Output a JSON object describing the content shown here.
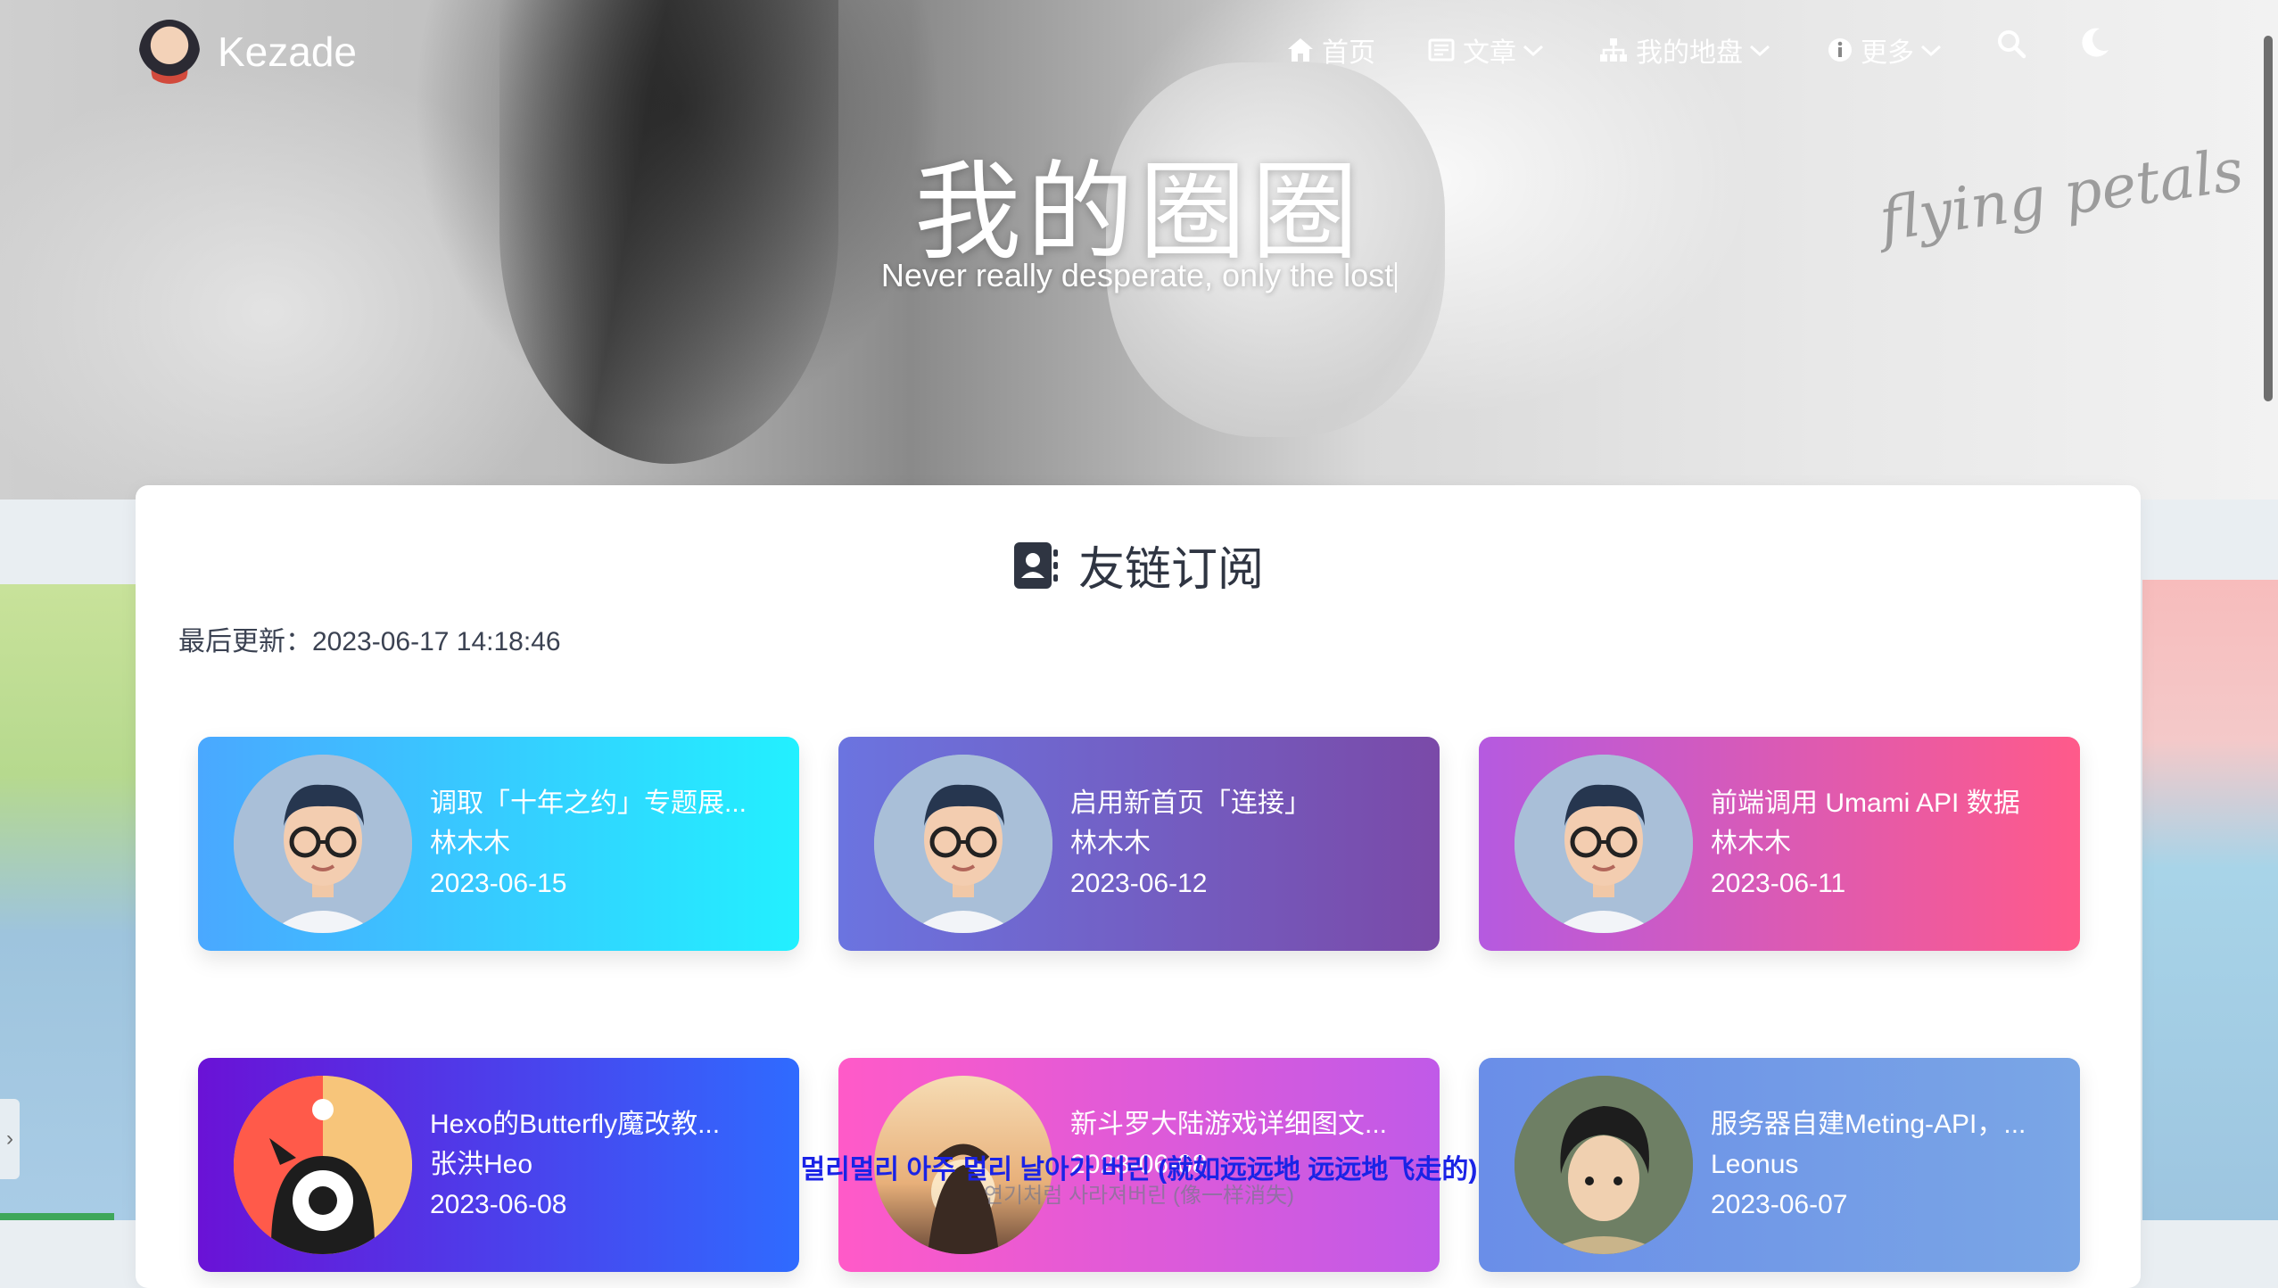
{
  "nav": {
    "brand": "Kezade",
    "items": [
      {
        "label": "首页",
        "icon": "home-icon"
      },
      {
        "label": "文章",
        "icon": "book-icon"
      },
      {
        "label": "我的地盘",
        "icon": "sitemap-icon"
      },
      {
        "label": "更多",
        "icon": "info-icon"
      }
    ],
    "search_icon": "search-icon",
    "theme_icon": "moon-icon"
  },
  "hero": {
    "title": "我的圈圈",
    "subtitle": "Never really desperate, only the lost",
    "watermark": "flying petals"
  },
  "section": {
    "title": "友链订阅",
    "icon": "address-book-icon",
    "updated_label": "最后更新：2023-06-17 14:18:46"
  },
  "cards": [
    {
      "title": "调取「十年之约」专题展...",
      "author": "林木木",
      "date": "2023-06-15",
      "avatar": "boy-glasses-avatar",
      "gradient": [
        "#4aa8ff",
        "#22f0ff"
      ]
    },
    {
      "title": "启用新首页「连接」",
      "author": "林木木",
      "date": "2023-06-12",
      "avatar": "boy-glasses-avatar",
      "gradient": [
        "#6b74e0",
        "#7a4aa8"
      ]
    },
    {
      "title": "前端调用 Umami API 数据",
      "author": "林木木",
      "date": "2023-06-11",
      "avatar": "boy-glasses-avatar",
      "gradient": [
        "#b55ae0",
        "#ff5a8a"
      ]
    },
    {
      "title": "Hexo的Butterfly魔改教...",
      "author": "张洪Heo",
      "date": "2023-06-08",
      "avatar": "monster-avatar",
      "gradient": [
        "#6a12d6",
        "#2f6bff"
      ]
    },
    {
      "title": "新斗罗大陆游戏详细图文...",
      "author": "",
      "date": "2023-06-08",
      "avatar": "sunset-avatar",
      "gradient": [
        "#ff5ac8",
        "#c05ae8"
      ]
    },
    {
      "title": "服务器自建Meting-API，...",
      "author": "Leonus",
      "date": "2023-06-07",
      "avatar": "anime-boy-avatar",
      "gradient": [
        "#6a8ee8",
        "#7aa6e6"
      ]
    }
  ],
  "lyrics": {
    "line1": "멀리멀리 아주 멀리 날아가 버린 (就如远远地 远远地飞走的)",
    "line2": "연기처럼 사라져버린 (像一样消失)"
  }
}
